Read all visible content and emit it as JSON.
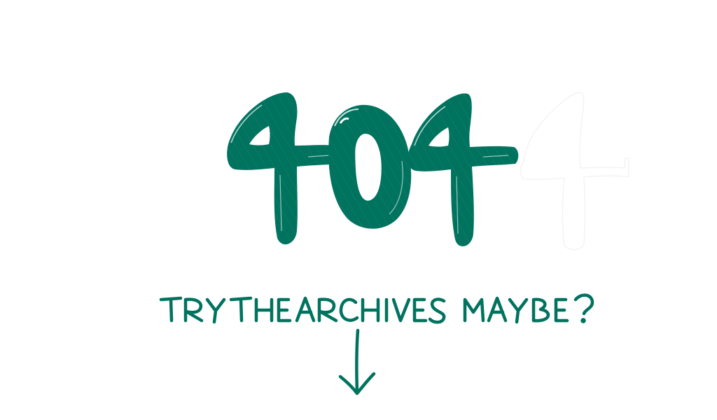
{
  "colors": {
    "ink": "#00735F",
    "background": "#FFFFFF",
    "ghost": "#FFFFFF"
  },
  "error": {
    "code": "404",
    "ghost_digit": "4"
  },
  "message": {
    "text": "TRY THE ARCHIVES MAYBE?"
  },
  "pointer": {
    "icon": "down-arrow-icon"
  }
}
